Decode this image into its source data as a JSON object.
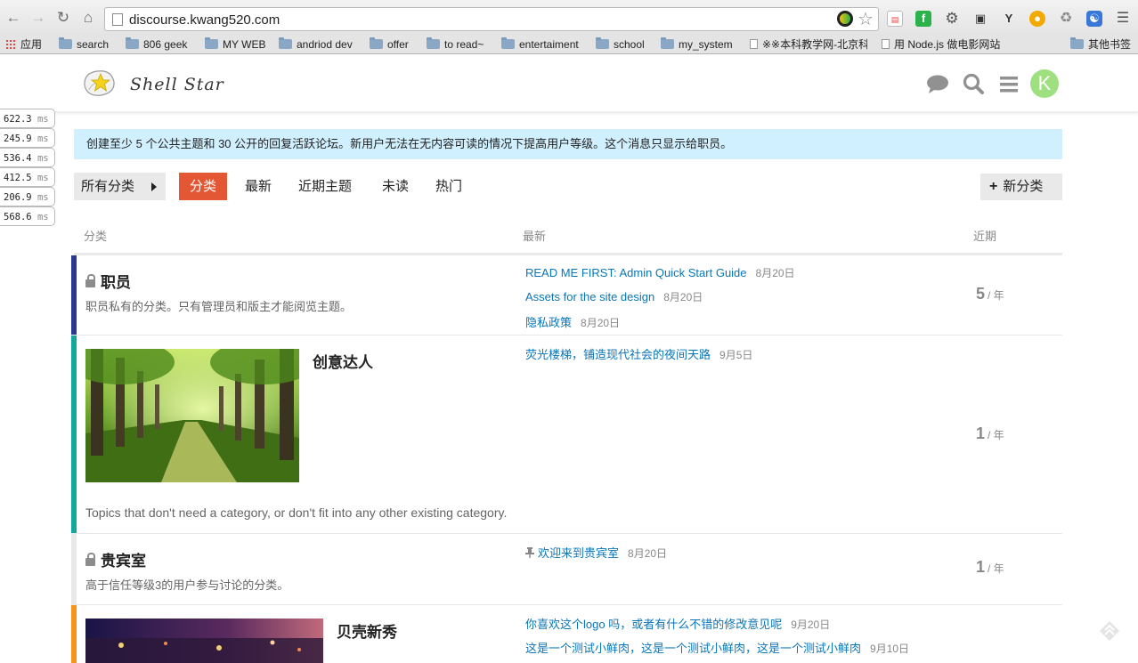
{
  "browser": {
    "url": "discourse.kwang520.com",
    "bookmarks": [
      {
        "label": "应用",
        "type": "apps"
      },
      {
        "label": "search",
        "type": "folder"
      },
      {
        "label": "806 geek",
        "type": "folder"
      },
      {
        "label": "MY WEB",
        "type": "folder"
      },
      {
        "label": "andriod dev",
        "type": "folder"
      },
      {
        "label": "offer",
        "type": "folder"
      },
      {
        "label": "to read~",
        "type": "folder"
      },
      {
        "label": "entertaiment",
        "type": "folder"
      },
      {
        "label": "school",
        "type": "folder"
      },
      {
        "label": "my_system",
        "type": "folder"
      },
      {
        "label": "※※本科教学网-北京科",
        "type": "page"
      },
      {
        "label": "用 Node.js 做电影网站",
        "type": "page"
      },
      {
        "label": "其他书签",
        "type": "folder"
      }
    ]
  },
  "perf": [
    "622.3",
    "245.9",
    "536.4",
    "412.5",
    "206.9",
    "568.6"
  ],
  "perf_unit": "ms",
  "site": {
    "logo_text": "Shell Star",
    "avatar_letter": "K",
    "colors": {
      "accent": "#e45735",
      "notice_bg": "#d1f0ff",
      "link": "#0a76b7",
      "avatar": "#9ee080"
    }
  },
  "notice": "创建至少 5 个公共主题和 30 公开的回复活跃论坛。新用户无法在无内容可读的情况下提高用户等级。这个消息只显示给职员。",
  "nav": {
    "all_categories": "所有分类",
    "tabs": [
      "分类",
      "最新",
      "近期主题",
      "未读",
      "热门"
    ],
    "active_tab": "分类",
    "new_category": "新分类"
  },
  "table": {
    "headers": {
      "category": "分类",
      "latest": "最新",
      "recent": "近期"
    },
    "rows": [
      {
        "name": "职员",
        "locked": true,
        "color": "#283890",
        "description": "职员私有的分类。只有管理员和版主才能阅览主题。",
        "topics": [
          {
            "title": "READ ME FIRST: Admin Quick Start Guide",
            "date": "8月20日"
          },
          {
            "title": "Assets for the site design",
            "date": "8月20日"
          },
          {
            "title": "隐私政策",
            "date": "8月20日"
          }
        ],
        "stat": "5",
        "stat_unit": "/ 年"
      },
      {
        "name": "创意达人",
        "locked": false,
        "color": "#12a89d",
        "image": "forest-path",
        "description": "Topics that don't need a category, or don't fit into any other existing category.",
        "topics": [
          {
            "title": "荧光楼梯，铺造现代社会的夜间天路",
            "date": "9月5日"
          }
        ],
        "stat": "1",
        "stat_unit": "/ 年"
      },
      {
        "name": "贵宾室",
        "locked": true,
        "color": "#e9e9e9",
        "description": "高于信任等级3的用户参与讨论的分类。",
        "topics": [
          {
            "title": "欢迎来到贵宾室",
            "date": "8月20日",
            "pinned": true
          }
        ],
        "stat": "1",
        "stat_unit": "/ 年"
      },
      {
        "name": "贝壳新秀",
        "locked": false,
        "color": "#f7941d",
        "image": "night-city",
        "topics": [
          {
            "title": "你喜欢这个logo 吗，或者有什么不错的修改意见呢",
            "date": "9月20日"
          },
          {
            "title": "这是一个测试小鲜肉，这是一个测试小鲜肉，这是一个测试小鲜肉",
            "date": "9月10日"
          }
        ]
      }
    ]
  }
}
